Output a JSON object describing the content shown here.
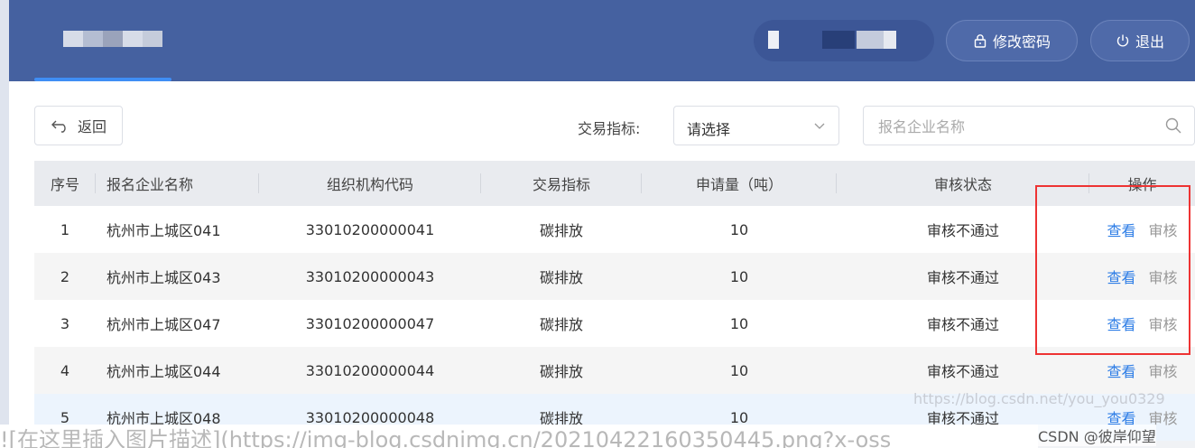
{
  "header": {
    "change_password": "修改密码",
    "logout": "退出",
    "colors": {
      "bg": "#4561a0",
      "accent": "#3f8ef5"
    }
  },
  "toolbar": {
    "back": "返回",
    "filter_label": "交易指标:",
    "filter_value": "请选择",
    "search_placeholder": "报名企业名称"
  },
  "table": {
    "columns": [
      "序号",
      "报名企业名称",
      "组织机构代码",
      "交易指标",
      "申请量（吨）",
      "审核状态",
      "操作"
    ],
    "action_view": "查看",
    "action_audit": "审核",
    "rows": [
      {
        "no": "1",
        "name": "杭州市上城区041",
        "code": "33010200000041",
        "indicator": "碳排放",
        "amount": "10",
        "status": "审核不通过"
      },
      {
        "no": "2",
        "name": "杭州市上城区043",
        "code": "33010200000043",
        "indicator": "碳排放",
        "amount": "10",
        "status": "审核不通过"
      },
      {
        "no": "3",
        "name": "杭州市上城区047",
        "code": "33010200000047",
        "indicator": "碳排放",
        "amount": "10",
        "status": "审核不通过"
      },
      {
        "no": "4",
        "name": "杭州市上城区044",
        "code": "33010200000044",
        "indicator": "碳排放",
        "amount": "10",
        "status": "审核不通过"
      },
      {
        "no": "5",
        "name": "杭州市上城区048",
        "code": "33010200000048",
        "indicator": "碳排放",
        "amount": "10",
        "status": "审核不通过"
      }
    ]
  },
  "watermark": {
    "blog": "https://blog.csdn.net/you_you0329",
    "csdn": "CSDN @彼岸仰望",
    "caption": "![在这里插入图片描述](https://img-blog.csdnimg.cn/20210422160350445.png?x-oss"
  }
}
